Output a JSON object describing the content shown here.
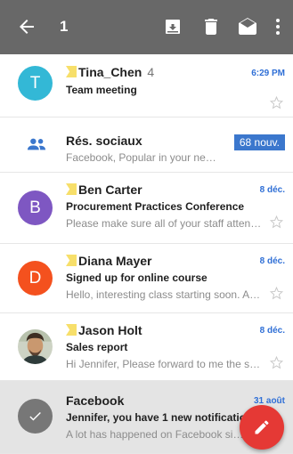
{
  "toolbar": {
    "selected_count": "1",
    "icons": [
      "arrow-back-icon",
      "archive-icon",
      "delete-icon",
      "mark-unread-icon",
      "more-vert-icon"
    ]
  },
  "emails": [
    {
      "avatar_letter": "T",
      "avatar_color": "#33b8d6",
      "sender": "Tina_Chen",
      "thread_count": "4",
      "subject": "Team meeting",
      "preview": "",
      "date": "6:29 PM",
      "important": true
    },
    {
      "sender": "Rés. sociaux",
      "preview": "Facebook, Popular in your net…",
      "badge": "68 nouv.",
      "category": "social"
    },
    {
      "avatar_letter": "B",
      "avatar_color": "#7e57c2",
      "sender": "Ben Carter",
      "subject": "Procurement Practices Conference",
      "preview": "Please make sure all of your staff atten…",
      "date": "8 déc.",
      "important": true
    },
    {
      "avatar_letter": "D",
      "avatar_color": "#f4511e",
      "sender": "Diana Mayer",
      "subject": "Signed up for online course",
      "preview": "Hello, interesting class starting soon. A…",
      "date": "8 déc.",
      "important": true
    },
    {
      "avatar_letter": "",
      "avatar_color": "#5a4f3f",
      "sender": "Jason Holt",
      "subject": "Sales report",
      "preview": "Hi Jennifer, Please forward to me the s…",
      "date": "8 déc.",
      "important": true
    },
    {
      "avatar_letter": "",
      "avatar_color": "#777777",
      "sender": "Facebook",
      "subject": "Jennifer, you have 1 new notification",
      "preview": "A lot has happened on Facebook si…",
      "date": "31 août",
      "important": false,
      "selected": true
    }
  ],
  "colors": {
    "appbar": "#686868",
    "accent": "#2f6fd6",
    "fab": "#e53935",
    "tag": "#f7df6a"
  }
}
